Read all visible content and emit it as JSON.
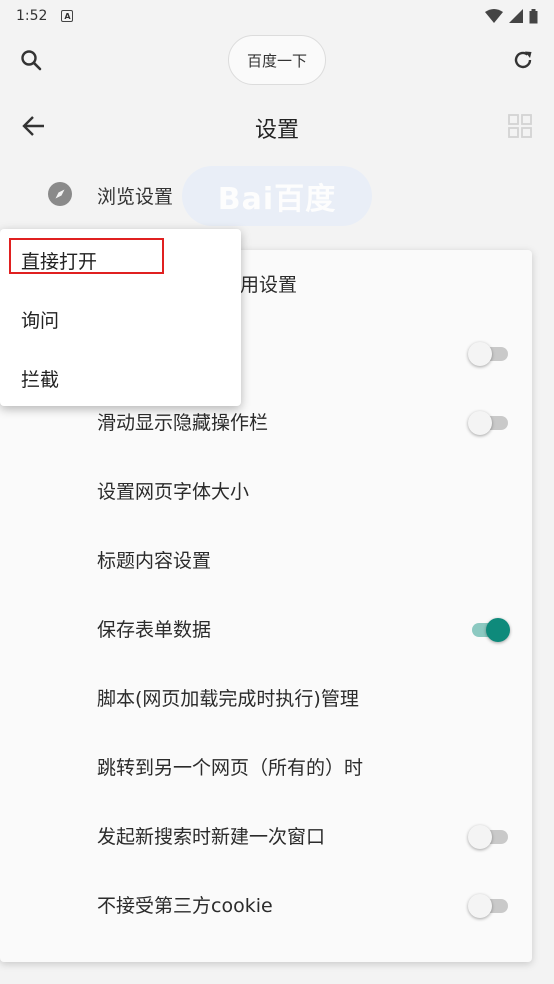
{
  "status_bar": {
    "time": "1:52",
    "a_icon": "A"
  },
  "toolbar": {
    "search_label": "百度一下"
  },
  "header": {
    "title": "设置"
  },
  "browse": {
    "label": "浏览设置",
    "watermark": "Bai百度"
  },
  "settings": {
    "partial_label": "用设置",
    "items": [
      {
        "label": "",
        "toggle": "off"
      },
      {
        "label": "滑动显示隐藏操作栏",
        "toggle": "off"
      },
      {
        "label": "设置网页字体大小"
      },
      {
        "label": "标题内容设置"
      },
      {
        "label": "保存表单数据",
        "toggle": "on"
      },
      {
        "label": "脚本(网页加载完成时执行)管理"
      },
      {
        "label": "跳转到另一个网页（所有的）时"
      },
      {
        "label": "发起新搜索时新建一次窗口",
        "toggle": "off"
      },
      {
        "label": "不接受第三方cookie",
        "toggle": "off"
      }
    ]
  },
  "popup": {
    "items": [
      {
        "label": "直接打开",
        "highlighted": true
      },
      {
        "label": "询问"
      },
      {
        "label": "拦截"
      }
    ]
  },
  "colors": {
    "accent": "#0e8a7b",
    "highlight_border": "#e02020"
  }
}
